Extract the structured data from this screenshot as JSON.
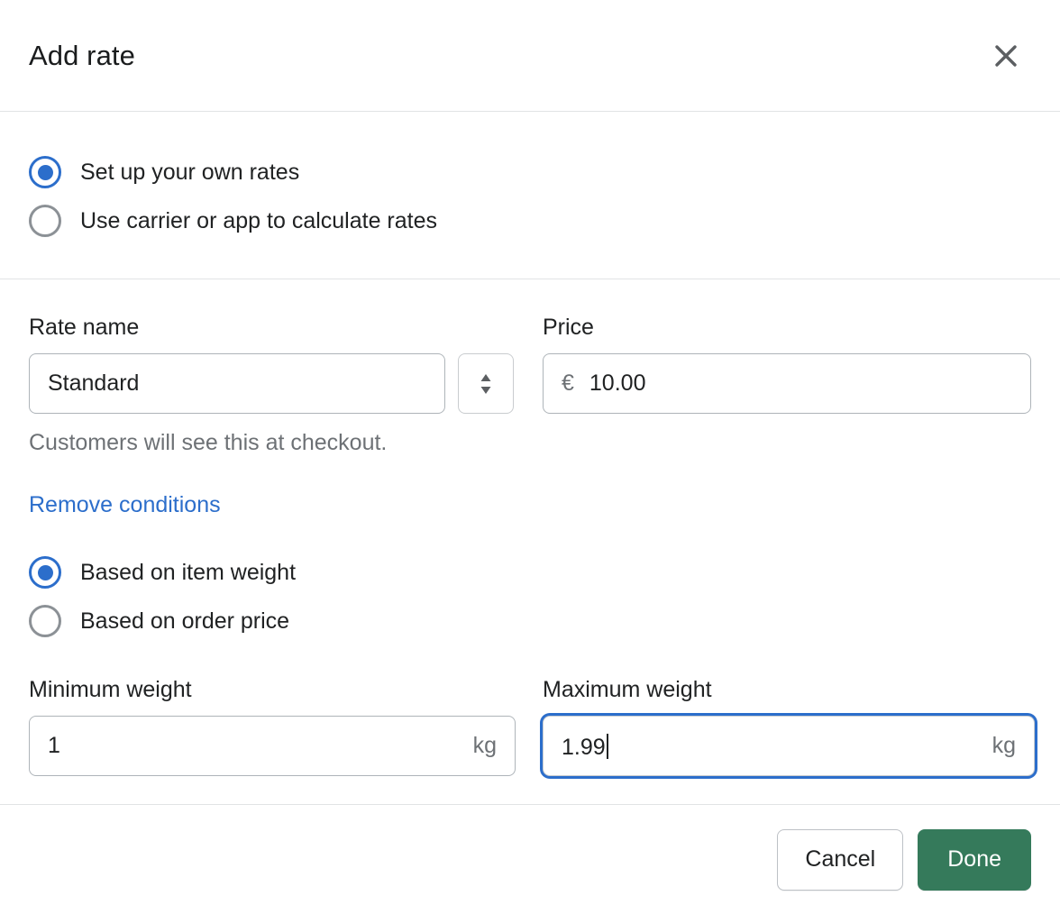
{
  "modal": {
    "title": "Add rate",
    "close_icon": "close-icon"
  },
  "rate_mode": {
    "options": [
      {
        "label": "Set up your own rates",
        "selected": true
      },
      {
        "label": "Use carrier or app to calculate rates",
        "selected": false
      }
    ]
  },
  "rate_name": {
    "label": "Rate name",
    "value": "Standard",
    "placeholder": "Rate name",
    "help_text": "Customers will see this at checkout.",
    "stepper_icon": "up-down-chevron-icon"
  },
  "price": {
    "label": "Price",
    "currency_symbol": "€",
    "value": "10.00",
    "placeholder": "0.00"
  },
  "conditions": {
    "remove_label": "Remove conditions",
    "options": [
      {
        "label": "Based on item weight",
        "selected": true
      },
      {
        "label": "Based on order price",
        "selected": false
      }
    ]
  },
  "minimum_weight": {
    "label": "Minimum weight",
    "value": "1",
    "placeholder": "0",
    "unit": "kg"
  },
  "maximum_weight": {
    "label": "Maximum weight",
    "value": "1.99",
    "placeholder": "0",
    "unit": "kg",
    "focused": true
  },
  "footer": {
    "cancel_label": "Cancel",
    "done_label": "Done"
  },
  "colors": {
    "accent_blue": "#2c6ecb",
    "primary_green": "#357a5b",
    "border": "#e1e3e5",
    "text": "#202223",
    "subdued_text": "#6d7175"
  }
}
